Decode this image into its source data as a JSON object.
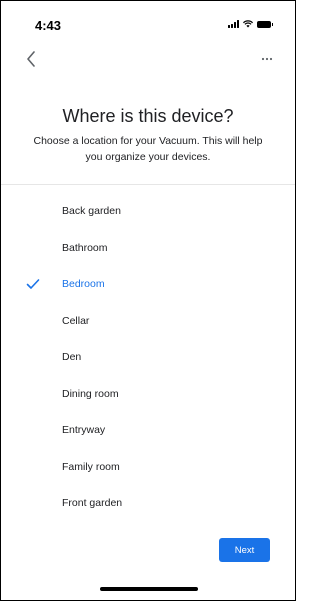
{
  "status_bar": {
    "time": "4:43"
  },
  "nav": {
    "back_icon": "chevron-left-icon",
    "more_icon": "more-horizontal-icon"
  },
  "header": {
    "title": "Where is this device?",
    "subtitle": "Choose a location for your Vacuum. This will help you organize your devices."
  },
  "rooms": [
    {
      "label": "Back garden",
      "selected": false
    },
    {
      "label": "Bathroom",
      "selected": false
    },
    {
      "label": "Bedroom",
      "selected": true
    },
    {
      "label": "Cellar",
      "selected": false
    },
    {
      "label": "Den",
      "selected": false
    },
    {
      "label": "Dining room",
      "selected": false
    },
    {
      "label": "Entryway",
      "selected": false
    },
    {
      "label": "Family room",
      "selected": false
    },
    {
      "label": "Front garden",
      "selected": false
    }
  ],
  "footer": {
    "next_label": "Next"
  },
  "colors": {
    "accent": "#1a73e8",
    "text": "#202124"
  }
}
